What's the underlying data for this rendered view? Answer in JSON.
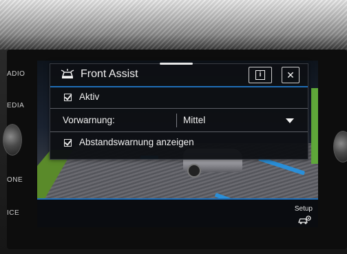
{
  "side_buttons": {
    "radio": "ADIO",
    "media": "EDIA",
    "phone": "ONE",
    "voice": "ICE"
  },
  "popup": {
    "title": "Front Assist",
    "title_icon": "front-assist-car-icon",
    "info_button_glyph": "i",
    "close_button_glyph": "✕",
    "aktiv_label": "Aktiv",
    "aktiv_checked": true,
    "vorwarnung_label": "Vorwarnung:",
    "vorwarnung_value": "Mittel",
    "abstand_label": "Abstandswarnung anzeigen",
    "abstand_checked": true
  },
  "bottom_bar": {
    "setup_label": "Setup",
    "setup_icon": "car-gear-icon"
  },
  "colors": {
    "accent_blue": "#1f6fb8",
    "lane_blue": "#2a8fd8",
    "grass_green": "#5a8a2a"
  }
}
